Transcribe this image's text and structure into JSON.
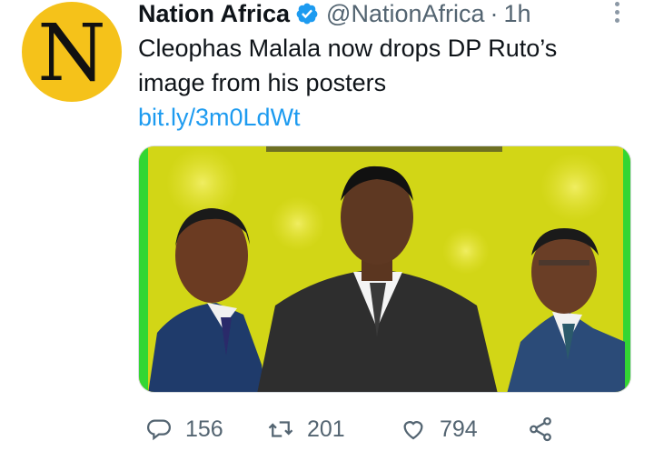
{
  "account": {
    "avatar_letter": "N",
    "avatar_color": "#f5c21a",
    "display_name": "Nation Africa",
    "handle": "@NationAfrica",
    "separator": "·",
    "time": "1h",
    "verified": true
  },
  "tweet": {
    "text": "Cleophas Malala now drops DP Ruto’s image from his posters",
    "link": "bit.ly/3m0LdWt",
    "link_color": "#1d9bf0"
  },
  "media": {
    "background_color": "#d4d817",
    "frame_color": "#33d633"
  },
  "actions": {
    "reply": {
      "icon": "reply-icon",
      "count": "156"
    },
    "retweet": {
      "icon": "retweet-icon",
      "count": "201"
    },
    "like": {
      "icon": "heart-icon",
      "count": "794"
    },
    "share": {
      "icon": "share-icon"
    }
  }
}
